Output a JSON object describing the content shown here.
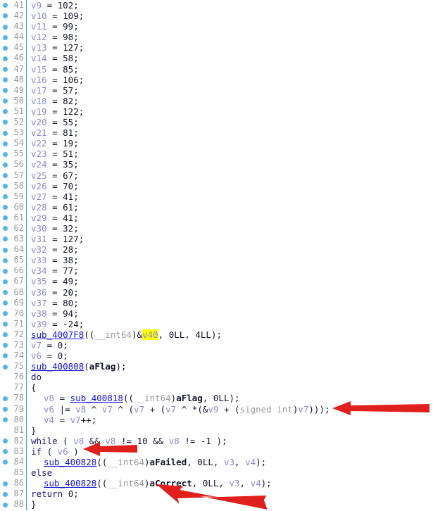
{
  "editor": {
    "title": "decompiled-pseudocode-view",
    "first_line": 41,
    "last_line": 88,
    "gutter_separator_color": "#3c9fe0",
    "breakpoint_dot_color": "#4fb4ef",
    "line_number_color": "#9a9a9a",
    "background_color": "#ffffff",
    "highlight_color": "#ffff00",
    "annotation_arrow_color": "#e0201c"
  },
  "lines": [
    {
      "n": "41",
      "bp": true,
      "indent": 0,
      "tokens": [
        {
          "t": "v9",
          "c": "var"
        },
        {
          "t": " = ",
          "c": "op"
        },
        {
          "t": "102",
          "c": "num"
        },
        {
          "t": ";",
          "c": "punc"
        }
      ]
    },
    {
      "n": "42",
      "bp": true,
      "indent": 0,
      "tokens": [
        {
          "t": "v10",
          "c": "var"
        },
        {
          "t": " = ",
          "c": "op"
        },
        {
          "t": "109",
          "c": "num"
        },
        {
          "t": ";",
          "c": "punc"
        }
      ]
    },
    {
      "n": "43",
      "bp": true,
      "indent": 0,
      "tokens": [
        {
          "t": "v11",
          "c": "var"
        },
        {
          "t": " = ",
          "c": "op"
        },
        {
          "t": "99",
          "c": "num"
        },
        {
          "t": ";",
          "c": "punc"
        }
      ]
    },
    {
      "n": "44",
      "bp": true,
      "indent": 0,
      "tokens": [
        {
          "t": "v12",
          "c": "var"
        },
        {
          "t": " = ",
          "c": "op"
        },
        {
          "t": "98",
          "c": "num"
        },
        {
          "t": ";",
          "c": "punc"
        }
      ]
    },
    {
      "n": "45",
      "bp": true,
      "indent": 0,
      "tokens": [
        {
          "t": "v13",
          "c": "var"
        },
        {
          "t": " = ",
          "c": "op"
        },
        {
          "t": "127",
          "c": "num"
        },
        {
          "t": ";",
          "c": "punc"
        }
      ]
    },
    {
      "n": "46",
      "bp": true,
      "indent": 0,
      "tokens": [
        {
          "t": "v14",
          "c": "var"
        },
        {
          "t": " = ",
          "c": "op"
        },
        {
          "t": "58",
          "c": "num"
        },
        {
          "t": ";",
          "c": "punc"
        }
      ]
    },
    {
      "n": "47",
      "bp": true,
      "indent": 0,
      "tokens": [
        {
          "t": "v15",
          "c": "var"
        },
        {
          "t": " = ",
          "c": "op"
        },
        {
          "t": "85",
          "c": "num"
        },
        {
          "t": ";",
          "c": "punc"
        }
      ]
    },
    {
      "n": "48",
      "bp": true,
      "indent": 0,
      "tokens": [
        {
          "t": "v16",
          "c": "var"
        },
        {
          "t": " = ",
          "c": "op"
        },
        {
          "t": "106",
          "c": "num"
        },
        {
          "t": ";",
          "c": "punc"
        }
      ]
    },
    {
      "n": "49",
      "bp": true,
      "indent": 0,
      "tokens": [
        {
          "t": "v17",
          "c": "var"
        },
        {
          "t": " = ",
          "c": "op"
        },
        {
          "t": "57",
          "c": "num"
        },
        {
          "t": ";",
          "c": "punc"
        }
      ]
    },
    {
      "n": "50",
      "bp": true,
      "indent": 0,
      "tokens": [
        {
          "t": "v18",
          "c": "var"
        },
        {
          "t": " = ",
          "c": "op"
        },
        {
          "t": "82",
          "c": "num"
        },
        {
          "t": ";",
          "c": "punc"
        }
      ]
    },
    {
      "n": "51",
      "bp": true,
      "indent": 0,
      "tokens": [
        {
          "t": "v19",
          "c": "var"
        },
        {
          "t": " = ",
          "c": "op"
        },
        {
          "t": "122",
          "c": "num"
        },
        {
          "t": ";",
          "c": "punc"
        }
      ]
    },
    {
      "n": "52",
      "bp": true,
      "indent": 0,
      "tokens": [
        {
          "t": "v20",
          "c": "var"
        },
        {
          "t": " = ",
          "c": "op"
        },
        {
          "t": "55",
          "c": "num"
        },
        {
          "t": ";",
          "c": "punc"
        }
      ]
    },
    {
      "n": "53",
      "bp": true,
      "indent": 0,
      "tokens": [
        {
          "t": "v21",
          "c": "var"
        },
        {
          "t": " = ",
          "c": "op"
        },
        {
          "t": "81",
          "c": "num"
        },
        {
          "t": ";",
          "c": "punc"
        }
      ]
    },
    {
      "n": "54",
      "bp": true,
      "indent": 0,
      "tokens": [
        {
          "t": "v22",
          "c": "var"
        },
        {
          "t": " = ",
          "c": "op"
        },
        {
          "t": "19",
          "c": "num"
        },
        {
          "t": ";",
          "c": "punc"
        }
      ]
    },
    {
      "n": "55",
      "bp": true,
      "indent": 0,
      "tokens": [
        {
          "t": "v23",
          "c": "var"
        },
        {
          "t": " = ",
          "c": "op"
        },
        {
          "t": "51",
          "c": "num"
        },
        {
          "t": ";",
          "c": "punc"
        }
      ]
    },
    {
      "n": "56",
      "bp": true,
      "indent": 0,
      "tokens": [
        {
          "t": "v24",
          "c": "var"
        },
        {
          "t": " = ",
          "c": "op"
        },
        {
          "t": "35",
          "c": "num"
        },
        {
          "t": ";",
          "c": "punc"
        }
      ]
    },
    {
      "n": "57",
      "bp": true,
      "indent": 0,
      "tokens": [
        {
          "t": "v25",
          "c": "var"
        },
        {
          "t": " = ",
          "c": "op"
        },
        {
          "t": "67",
          "c": "num"
        },
        {
          "t": ";",
          "c": "punc"
        }
      ]
    },
    {
      "n": "58",
      "bp": true,
      "indent": 0,
      "tokens": [
        {
          "t": "v26",
          "c": "var"
        },
        {
          "t": " = ",
          "c": "op"
        },
        {
          "t": "70",
          "c": "num"
        },
        {
          "t": ";",
          "c": "punc"
        }
      ]
    },
    {
      "n": "59",
      "bp": true,
      "indent": 0,
      "tokens": [
        {
          "t": "v27",
          "c": "var"
        },
        {
          "t": " = ",
          "c": "op"
        },
        {
          "t": "41",
          "c": "num"
        },
        {
          "t": ";",
          "c": "punc"
        }
      ]
    },
    {
      "n": "60",
      "bp": true,
      "indent": 0,
      "tokens": [
        {
          "t": "v28",
          "c": "var"
        },
        {
          "t": " = ",
          "c": "op"
        },
        {
          "t": "61",
          "c": "num"
        },
        {
          "t": ";",
          "c": "punc"
        }
      ]
    },
    {
      "n": "61",
      "bp": true,
      "indent": 0,
      "tokens": [
        {
          "t": "v29",
          "c": "var"
        },
        {
          "t": " = ",
          "c": "op"
        },
        {
          "t": "41",
          "c": "num"
        },
        {
          "t": ";",
          "c": "punc"
        }
      ]
    },
    {
      "n": "62",
      "bp": true,
      "indent": 0,
      "tokens": [
        {
          "t": "v30",
          "c": "var"
        },
        {
          "t": " = ",
          "c": "op"
        },
        {
          "t": "32",
          "c": "num"
        },
        {
          "t": ";",
          "c": "punc"
        }
      ]
    },
    {
      "n": "63",
      "bp": true,
      "indent": 0,
      "tokens": [
        {
          "t": "v31",
          "c": "var"
        },
        {
          "t": " = ",
          "c": "op"
        },
        {
          "t": "127",
          "c": "num"
        },
        {
          "t": ";",
          "c": "punc"
        }
      ]
    },
    {
      "n": "64",
      "bp": true,
      "indent": 0,
      "tokens": [
        {
          "t": "v32",
          "c": "var"
        },
        {
          "t": " = ",
          "c": "op"
        },
        {
          "t": "28",
          "c": "num"
        },
        {
          "t": ";",
          "c": "punc"
        }
      ]
    },
    {
      "n": "65",
      "bp": true,
      "indent": 0,
      "tokens": [
        {
          "t": "v33",
          "c": "var"
        },
        {
          "t": " = ",
          "c": "op"
        },
        {
          "t": "38",
          "c": "num"
        },
        {
          "t": ";",
          "c": "punc"
        }
      ]
    },
    {
      "n": "66",
      "bp": true,
      "indent": 0,
      "tokens": [
        {
          "t": "v34",
          "c": "var"
        },
        {
          "t": " = ",
          "c": "op"
        },
        {
          "t": "77",
          "c": "num"
        },
        {
          "t": ";",
          "c": "punc"
        }
      ]
    },
    {
      "n": "67",
      "bp": true,
      "indent": 0,
      "tokens": [
        {
          "t": "v35",
          "c": "var"
        },
        {
          "t": " = ",
          "c": "op"
        },
        {
          "t": "49",
          "c": "num"
        },
        {
          "t": ";",
          "c": "punc"
        }
      ]
    },
    {
      "n": "68",
      "bp": true,
      "indent": 0,
      "tokens": [
        {
          "t": "v36",
          "c": "var"
        },
        {
          "t": " = ",
          "c": "op"
        },
        {
          "t": "20",
          "c": "num"
        },
        {
          "t": ";",
          "c": "punc"
        }
      ]
    },
    {
      "n": "69",
      "bp": true,
      "indent": 0,
      "tokens": [
        {
          "t": "v37",
          "c": "var"
        },
        {
          "t": " = ",
          "c": "op"
        },
        {
          "t": "80",
          "c": "num"
        },
        {
          "t": ";",
          "c": "punc"
        }
      ]
    },
    {
      "n": "70",
      "bp": true,
      "indent": 0,
      "tokens": [
        {
          "t": "v38",
          "c": "var"
        },
        {
          "t": " = ",
          "c": "op"
        },
        {
          "t": "94",
          "c": "num"
        },
        {
          "t": ";",
          "c": "punc"
        }
      ]
    },
    {
      "n": "71",
      "bp": true,
      "indent": 0,
      "tokens": [
        {
          "t": "v39",
          "c": "var"
        },
        {
          "t": " = ",
          "c": "op"
        },
        {
          "t": "-24",
          "c": "num"
        },
        {
          "t": ";",
          "c": "punc"
        }
      ]
    },
    {
      "n": "72",
      "bp": true,
      "indent": 0,
      "tokens": [
        {
          "t": "sub_4007F8",
          "c": "fn"
        },
        {
          "t": "((",
          "c": "punc"
        },
        {
          "t": "__int64",
          "c": "type"
        },
        {
          "t": ")&",
          "c": "punc"
        },
        {
          "t": "v40",
          "c": "hl"
        },
        {
          "t": ", ",
          "c": "punc"
        },
        {
          "t": "0LL",
          "c": "num"
        },
        {
          "t": ", ",
          "c": "punc"
        },
        {
          "t": "4LL",
          "c": "num"
        },
        {
          "t": ");",
          "c": "punc"
        }
      ]
    },
    {
      "n": "73",
      "bp": true,
      "indent": 0,
      "tokens": [
        {
          "t": "v7",
          "c": "var"
        },
        {
          "t": " = ",
          "c": "op"
        },
        {
          "t": "0",
          "c": "num"
        },
        {
          "t": ";",
          "c": "punc"
        }
      ]
    },
    {
      "n": "74",
      "bp": true,
      "indent": 0,
      "tokens": [
        {
          "t": "v6",
          "c": "var"
        },
        {
          "t": " = ",
          "c": "op"
        },
        {
          "t": "0",
          "c": "num"
        },
        {
          "t": ";",
          "c": "punc"
        }
      ]
    },
    {
      "n": "75",
      "bp": true,
      "indent": 0,
      "tokens": [
        {
          "t": "sub_400808",
          "c": "fn"
        },
        {
          "t": "(",
          "c": "punc"
        },
        {
          "t": "aFlag",
          "c": "str"
        },
        {
          "t": ");",
          "c": "punc"
        }
      ]
    },
    {
      "n": "76",
      "bp": false,
      "indent": 0,
      "tokens": [
        {
          "t": "do",
          "c": "kw"
        }
      ]
    },
    {
      "n": "77",
      "bp": false,
      "indent": 0,
      "tokens": [
        {
          "t": "{",
          "c": "punc"
        }
      ]
    },
    {
      "n": "78",
      "bp": true,
      "indent": 1,
      "tokens": [
        {
          "t": "v8",
          "c": "var"
        },
        {
          "t": " = ",
          "c": "op"
        },
        {
          "t": "sub_400818",
          "c": "fn"
        },
        {
          "t": "((",
          "c": "punc"
        },
        {
          "t": "__int64",
          "c": "type"
        },
        {
          "t": ")",
          "c": "punc"
        },
        {
          "t": "aFlag",
          "c": "str"
        },
        {
          "t": ", ",
          "c": "punc"
        },
        {
          "t": "0LL",
          "c": "num"
        },
        {
          "t": ");",
          "c": "punc"
        }
      ]
    },
    {
      "n": "79",
      "bp": true,
      "indent": 1,
      "tokens": [
        {
          "t": "v6",
          "c": "var"
        },
        {
          "t": " |= ",
          "c": "op"
        },
        {
          "t": "v8",
          "c": "var"
        },
        {
          "t": " ^ ",
          "c": "op"
        },
        {
          "t": "v7",
          "c": "var"
        },
        {
          "t": " ^ (",
          "c": "op"
        },
        {
          "t": "v7",
          "c": "var"
        },
        {
          "t": " + (",
          "c": "op"
        },
        {
          "t": "v7",
          "c": "var"
        },
        {
          "t": " ^ *(&",
          "c": "op"
        },
        {
          "t": "v9",
          "c": "var"
        },
        {
          "t": " + (",
          "c": "op"
        },
        {
          "t": "signed int",
          "c": "type"
        },
        {
          "t": ")",
          "c": "punc"
        },
        {
          "t": "v7",
          "c": "var"
        },
        {
          "t": ")));",
          "c": "punc"
        }
      ]
    },
    {
      "n": "80",
      "bp": true,
      "indent": 1,
      "tokens": [
        {
          "t": "v4",
          "c": "var"
        },
        {
          "t": " = ",
          "c": "op"
        },
        {
          "t": "v7",
          "c": "var"
        },
        {
          "t": "++;",
          "c": "punc"
        }
      ]
    },
    {
      "n": "81",
      "bp": false,
      "indent": 0,
      "tokens": [
        {
          "t": "}",
          "c": "punc"
        }
      ]
    },
    {
      "n": "82",
      "bp": true,
      "indent": 0,
      "tokens": [
        {
          "t": "while",
          "c": "kw"
        },
        {
          "t": " ( ",
          "c": "punc"
        },
        {
          "t": "v8",
          "c": "var"
        },
        {
          "t": " && ",
          "c": "op"
        },
        {
          "t": "v8",
          "c": "var"
        },
        {
          "t": " != ",
          "c": "op"
        },
        {
          "t": "10",
          "c": "num"
        },
        {
          "t": " && ",
          "c": "op"
        },
        {
          "t": "v8",
          "c": "var"
        },
        {
          "t": " != ",
          "c": "op"
        },
        {
          "t": "-1",
          "c": "num"
        },
        {
          "t": " );",
          "c": "punc"
        }
      ]
    },
    {
      "n": "83",
      "bp": true,
      "indent": 0,
      "tokens": [
        {
          "t": "if",
          "c": "kw"
        },
        {
          "t": " ( ",
          "c": "punc"
        },
        {
          "t": "v6",
          "c": "var"
        },
        {
          "t": " )",
          "c": "punc"
        }
      ]
    },
    {
      "n": "84",
      "bp": true,
      "indent": 1,
      "tokens": [
        {
          "t": "sub_400828",
          "c": "fn"
        },
        {
          "t": "((",
          "c": "punc"
        },
        {
          "t": "__int64",
          "c": "type"
        },
        {
          "t": ")",
          "c": "punc"
        },
        {
          "t": "aFailed",
          "c": "str"
        },
        {
          "t": ", ",
          "c": "punc"
        },
        {
          "t": "0LL",
          "c": "num"
        },
        {
          "t": ", ",
          "c": "punc"
        },
        {
          "t": "v3",
          "c": "var"
        },
        {
          "t": ", ",
          "c": "punc"
        },
        {
          "t": "v4",
          "c": "var"
        },
        {
          "t": ");",
          "c": "punc"
        }
      ]
    },
    {
      "n": "85",
      "bp": false,
      "indent": 0,
      "tokens": [
        {
          "t": "else",
          "c": "kw"
        }
      ]
    },
    {
      "n": "86",
      "bp": true,
      "indent": 1,
      "tokens": [
        {
          "t": "sub_400828",
          "c": "fn"
        },
        {
          "t": "((",
          "c": "punc"
        },
        {
          "t": "__int64",
          "c": "type"
        },
        {
          "t": ")",
          "c": "punc"
        },
        {
          "t": "aCorrect",
          "c": "str"
        },
        {
          "t": ", ",
          "c": "punc"
        },
        {
          "t": "0LL",
          "c": "num"
        },
        {
          "t": ", ",
          "c": "punc"
        },
        {
          "t": "v3",
          "c": "var"
        },
        {
          "t": ", ",
          "c": "punc"
        },
        {
          "t": "v4",
          "c": "var"
        },
        {
          "t": ");",
          "c": "punc"
        }
      ]
    },
    {
      "n": "87",
      "bp": true,
      "indent": 0,
      "tokens": [
        {
          "t": "return",
          "c": "kw"
        },
        {
          "t": " ",
          "c": "punc"
        },
        {
          "t": "0",
          "c": "num"
        },
        {
          "t": ";",
          "c": "punc"
        }
      ]
    },
    {
      "n": "88",
      "bp": true,
      "indent": 0,
      "tokens": [
        {
          "t": "}",
          "c": "punc"
        }
      ]
    }
  ],
  "annotations": [
    {
      "name": "arrow-line-79",
      "points_to_line": "79",
      "direction": "left",
      "color": "#e0201c"
    },
    {
      "name": "arrow-line-83",
      "points_to_line": "83",
      "direction": "left",
      "color": "#e0201c"
    },
    {
      "name": "arrow-line-86",
      "points_to_line": "86",
      "direction": "up-left",
      "color": "#e0201c"
    }
  ]
}
